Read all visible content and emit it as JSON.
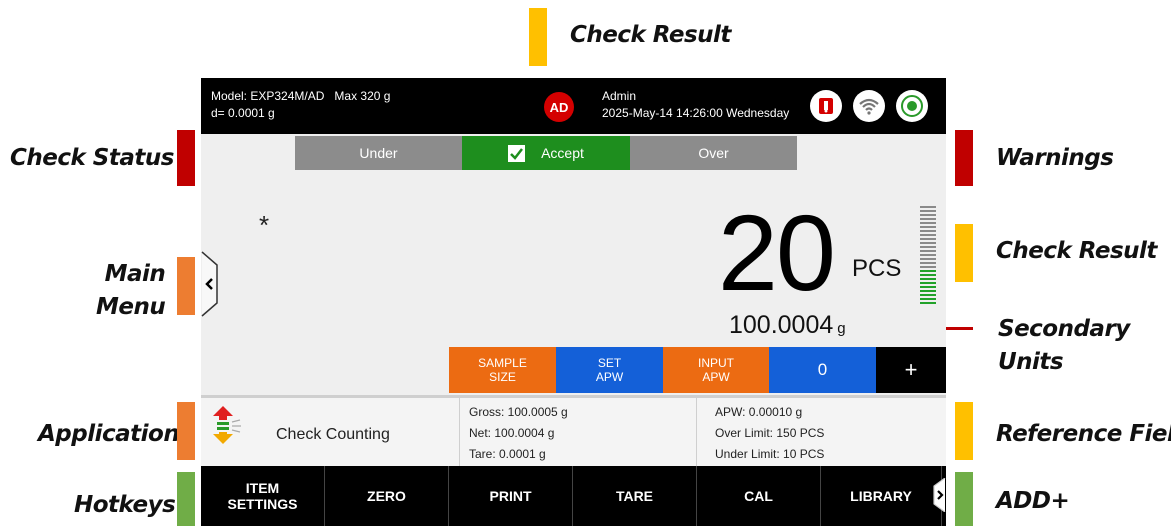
{
  "annotations": {
    "check_result_top": "Check Result",
    "check_status": "Check Status",
    "warnings": "Warnings",
    "main_menu_line1": "Main",
    "main_menu_line2": "Menu",
    "check_result_right": "Check Result",
    "secondary_units_line1": "Secondary",
    "secondary_units_line2": "Units",
    "application": "Application",
    "reference_field": "Reference Field",
    "hotkeys": "Hotkeys",
    "add_plus": "ADD+"
  },
  "colors": {
    "red_tag": "#c00000",
    "orange_tag": "#ed7d31",
    "yellow_tag": "#ffc000",
    "green_tag": "#70ad47",
    "accept_green": "#1e8e1e",
    "softkey_orange": "#ec6b12",
    "softkey_blue": "#1460d8"
  },
  "topbar": {
    "model": "Model: EXP324M/AD",
    "max": "Max 320 g",
    "d": "d= 0.0001 g",
    "user_initials": "AD",
    "user": "Admin",
    "datetime": "2025-May-14 14:26:00 Wednesday",
    "icons": [
      "usb-icon",
      "wifi-icon",
      "level-icon"
    ]
  },
  "check_status": {
    "under": "Under",
    "accept": "Accept",
    "over": "Over",
    "active": "accept"
  },
  "display": {
    "asterisk": "*",
    "main_value": "20",
    "main_unit": "PCS",
    "secondary_value": "100.0004",
    "secondary_unit": "g",
    "bargraph_fraction": 0.36
  },
  "softkeys": {
    "sample_size_1": "SAMPLE",
    "sample_size_2": "SIZE",
    "set_apw_1": "SET",
    "set_apw_2": "APW",
    "input_apw_1": "INPUT",
    "input_apw_2": "APW",
    "value": "0",
    "plus": "+"
  },
  "application": {
    "name": "Check Counting",
    "gross": "Gross: 100.0005 g",
    "net": "Net: 100.0004 g",
    "tare": "Tare: 0.0001 g",
    "apw": "APW: 0.00010 g",
    "over_limit": "Over Limit: 150 PCS",
    "under_limit": "Under Limit: 10 PCS"
  },
  "hotkeys": {
    "item_settings_1": "ITEM",
    "item_settings_2": "SETTINGS",
    "zero": "ZERO",
    "print": "PRINT",
    "tare": "TARE",
    "cal": "CAL",
    "library": "LIBRARY"
  }
}
